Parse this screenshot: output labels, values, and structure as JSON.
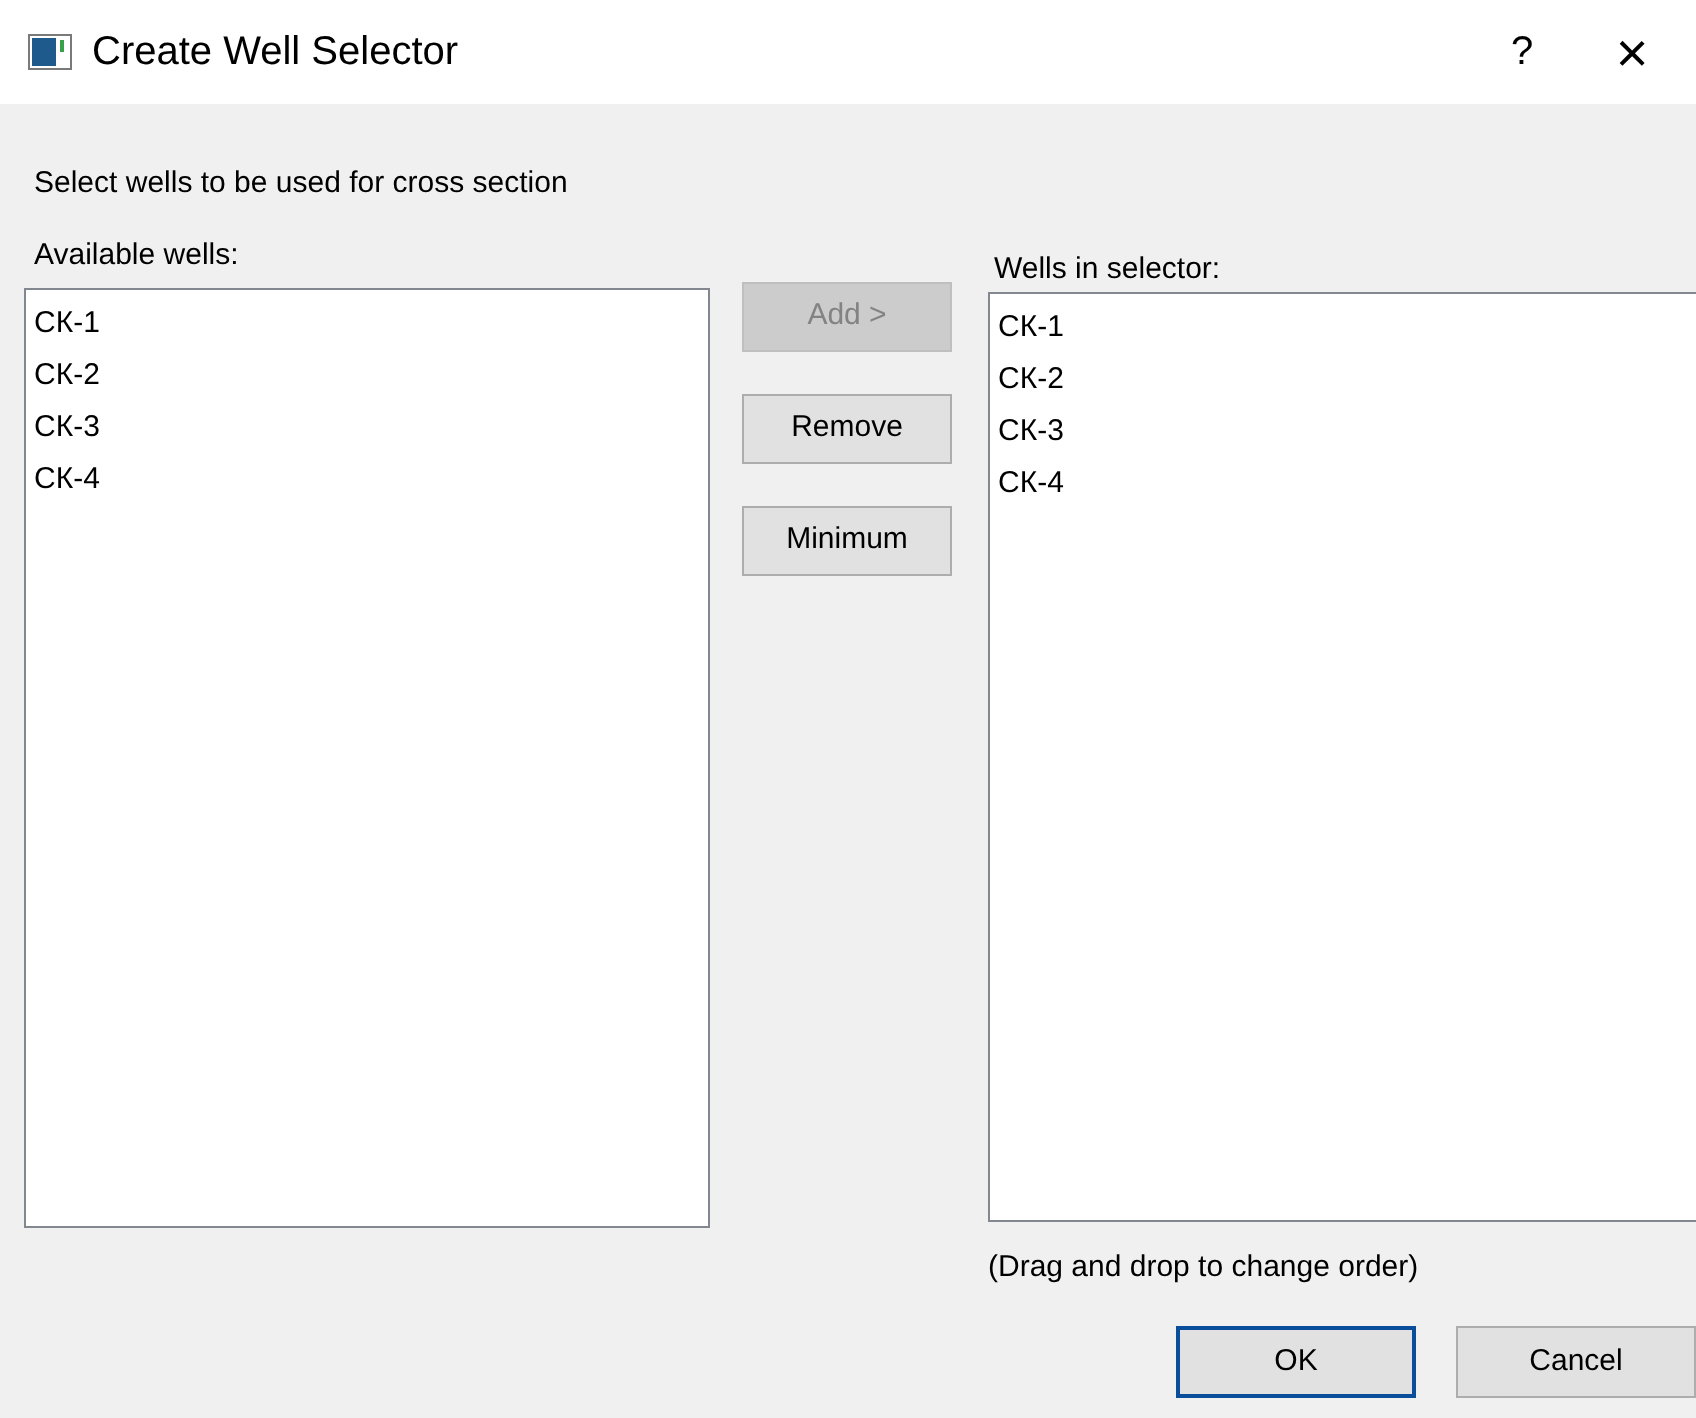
{
  "window": {
    "title": "Create Well Selector",
    "help": "?",
    "close": "×"
  },
  "instruction": "Select wells to be used for cross section",
  "available": {
    "label": "Available wells:",
    "items": [
      "СК-1",
      "СК-2",
      "СК-3",
      "СК-4"
    ]
  },
  "actions": [
    {
      "label": "Add >",
      "disabled": true
    },
    {
      "label": "Remove",
      "disabled": false
    },
    {
      "label": "Minimum",
      "disabled": false
    }
  ],
  "selector": {
    "label": "Wells in selector:",
    "items": [
      "СК-1",
      "СК-2",
      "СК-3",
      "СК-4"
    ]
  },
  "hint": "(Drag and drop to change order)",
  "buttons": [
    {
      "label": "OK",
      "default": true
    },
    {
      "label": "Cancel",
      "default": false
    }
  ]
}
